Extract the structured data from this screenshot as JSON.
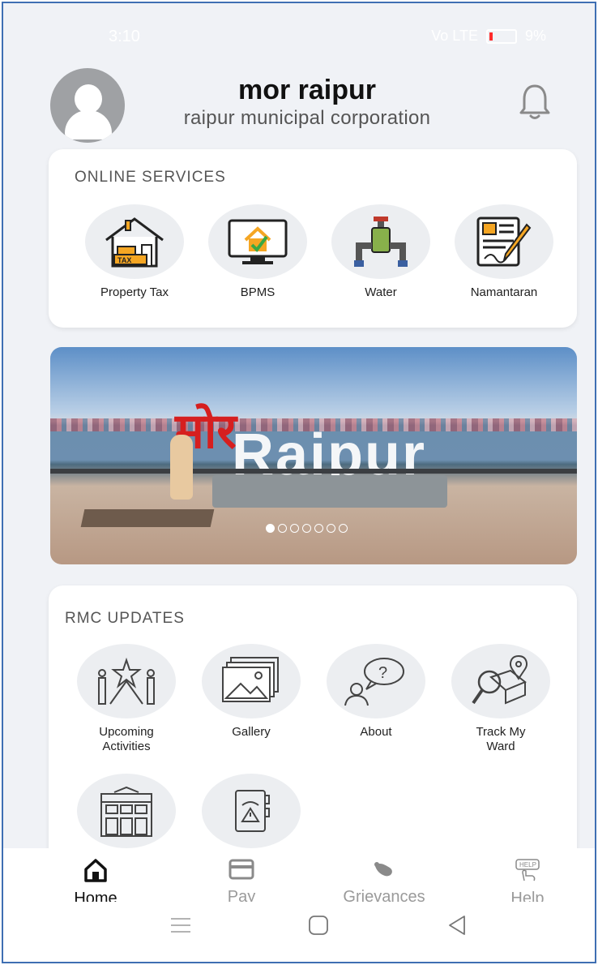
{
  "status_bar": {
    "time": "3:10",
    "signal_text": "Vo LTE",
    "battery_percent": "9%"
  },
  "header": {
    "title": "mor raipur",
    "subtitle": "raipur municipal corporation",
    "avatar_icon": "user-avatar-icon",
    "bell_icon": "bell-icon"
  },
  "online_services": {
    "title": "ONLINE SERVICES",
    "items": [
      {
        "label": "Property Tax",
        "icon": "property-tax-icon"
      },
      {
        "label": "BPMS",
        "icon": "bpms-icon"
      },
      {
        "label": "Water",
        "icon": "water-tap-icon"
      },
      {
        "label": "Namantaran",
        "icon": "namantaran-document-icon"
      }
    ]
  },
  "banner": {
    "sign_text_hindi": "मोर",
    "sign_text": "Raipur",
    "slide_count": 7,
    "active_slide": 1
  },
  "rmc_updates": {
    "title": "RMC UPDATES",
    "items": [
      {
        "label": "Upcoming Activities",
        "icon": "stage-star-icon"
      },
      {
        "label": "Gallery",
        "icon": "gallery-icon"
      },
      {
        "label": "About",
        "icon": "about-question-icon"
      },
      {
        "label": "Track My Ward",
        "icon": "track-ward-icon"
      },
      {
        "label": "",
        "icon": "building-icon"
      },
      {
        "label": "",
        "icon": "emergency-phone-icon"
      }
    ]
  },
  "bottom_nav": {
    "items": [
      {
        "label": "Home",
        "icon": "home-icon",
        "active": true
      },
      {
        "label": "Pay",
        "icon": "card-icon",
        "active": false
      },
      {
        "label": "Grievances",
        "icon": "grievance-icon",
        "active": false
      },
      {
        "label": "Help",
        "icon": "help-hand-icon",
        "active": false
      }
    ]
  },
  "colors": {
    "background": "#f0f2f6",
    "card": "#ffffff",
    "accent": "#3f6fb3",
    "icon_gray": "#eceef1"
  }
}
